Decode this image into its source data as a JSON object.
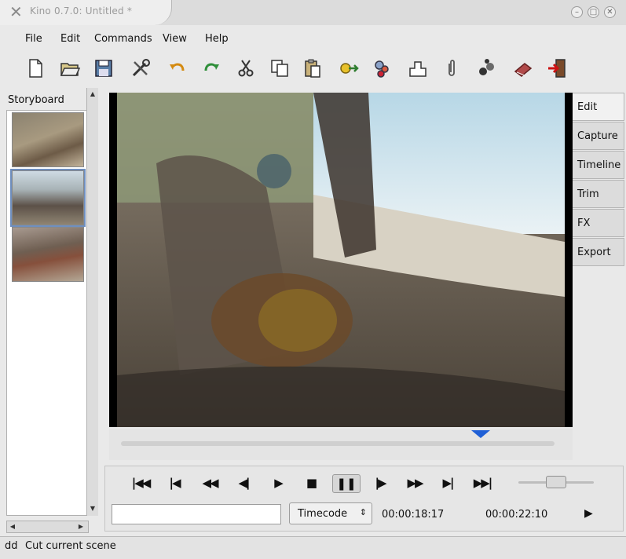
{
  "window": {
    "title": "Kino 0.7.0: Untitled *"
  },
  "menu": [
    {
      "label": "File"
    },
    {
      "label": "Edit"
    },
    {
      "label": "Commands"
    },
    {
      "label": "View"
    },
    {
      "label": "Help"
    }
  ],
  "toolbar": [
    {
      "icon": "new-file-icon"
    },
    {
      "icon": "open-folder-icon"
    },
    {
      "icon": "save-icon"
    },
    {
      "icon": "tools-icon"
    },
    {
      "icon": "undo-icon"
    },
    {
      "icon": "redo-icon"
    },
    {
      "icon": "cut-icon"
    },
    {
      "icon": "copy-icon"
    },
    {
      "icon": "paste-icon"
    },
    {
      "icon": "split-scene-icon"
    },
    {
      "icon": "join-scenes-icon"
    },
    {
      "icon": "insert-icon"
    },
    {
      "icon": "paperclip-icon"
    },
    {
      "icon": "effects-icon"
    },
    {
      "icon": "publish-icon"
    },
    {
      "icon": "exit-icon"
    }
  ],
  "storyboard": {
    "label": "Storyboard",
    "selected_index": 1,
    "clip_count": 3
  },
  "tabs": [
    {
      "label": "Edit",
      "active": true
    },
    {
      "label": "Capture"
    },
    {
      "label": "Timeline"
    },
    {
      "label": "Trim"
    },
    {
      "label": "FX"
    },
    {
      "label": "Export"
    }
  ],
  "playback": {
    "scrub_fraction": 0.83,
    "speed_fraction": 0.5,
    "timecode_format": "Timecode",
    "current_time": "00:00:18:17",
    "total_time": "00:00:22:10"
  },
  "transport": [
    {
      "icon": "go-to-start-icon",
      "glyph": "⏮"
    },
    {
      "icon": "previous-scene-icon",
      "glyph": "⏮"
    },
    {
      "icon": "rewind-icon",
      "glyph": "⏪"
    },
    {
      "icon": "back-frame-icon",
      "glyph": "◀"
    },
    {
      "icon": "play-icon",
      "glyph": "▶"
    },
    {
      "icon": "stop-icon",
      "glyph": "■"
    },
    {
      "icon": "pause-icon",
      "glyph": "⏸"
    },
    {
      "icon": "forward-frame-icon",
      "glyph": "▶"
    },
    {
      "icon": "fast-forward-icon",
      "glyph": "⏩"
    },
    {
      "icon": "next-scene-icon",
      "glyph": "⏭"
    },
    {
      "icon": "go-to-end-icon",
      "glyph": "⏭"
    }
  ],
  "status": {
    "left": "dd",
    "message": "Cut current scene"
  },
  "colors": {
    "accent": "#1f5fd6",
    "selection": "#6f8fbf"
  }
}
